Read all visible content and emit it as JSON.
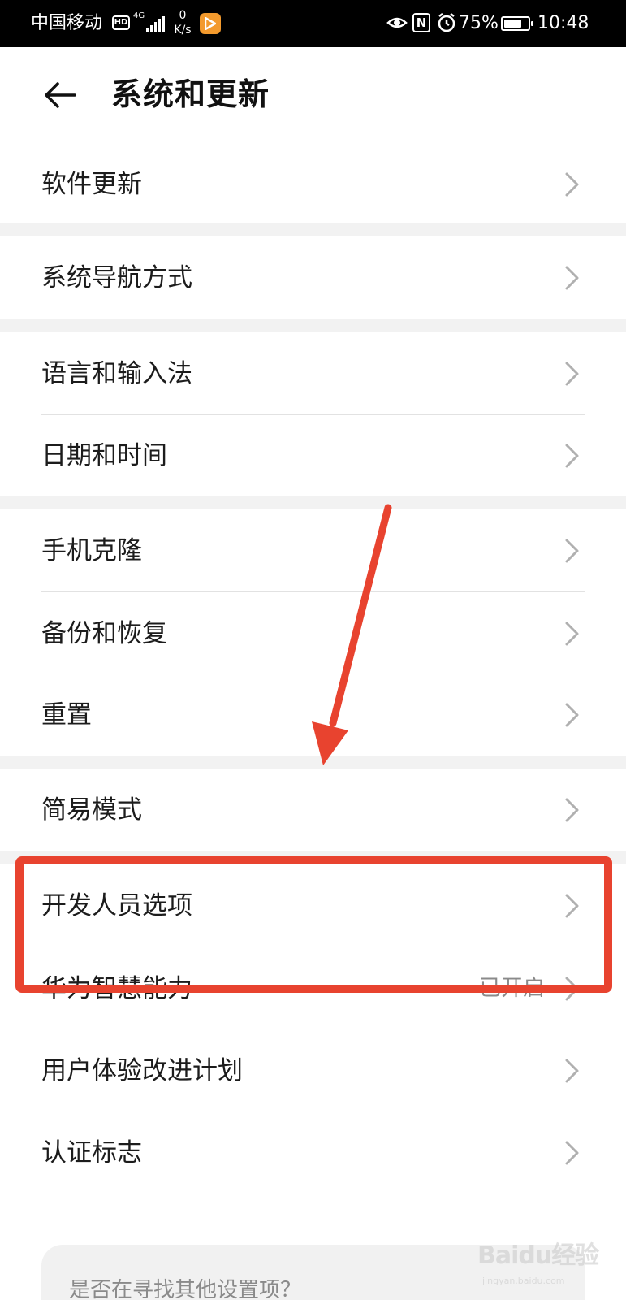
{
  "status_bar": {
    "carrier": "中国移动",
    "hd": "HD",
    "network": "4G",
    "speed_value": "0",
    "speed_unit": "K/s",
    "nfc": "N",
    "battery_percent": "75%",
    "battery_level": 0.75,
    "time": "10:48"
  },
  "header": {
    "title": "系统和更新"
  },
  "settings": {
    "software_update": "软件更新",
    "navigation": "系统导航方式",
    "language_input": "语言和输入法",
    "date_time": "日期和时间",
    "phone_clone": "手机克隆",
    "backup_restore": "备份和恢复",
    "reset": "重置",
    "simple_mode": "简易模式",
    "developer_options": "开发人员选项",
    "huawei_ai": "华为智慧能力",
    "huawei_ai_status": "已开启",
    "user_experience": "用户体验改进计划",
    "certification": "认证标志"
  },
  "suggestion": {
    "text": "是否在寻找其他设置项？"
  },
  "watermark": {
    "brand": "Baidu经验",
    "url": "jingyan.baidu.com"
  },
  "colors": {
    "annotation_red": "#e8432f",
    "group_gap": "#f2f2f2",
    "secondary_text": "#8a8a8a"
  }
}
